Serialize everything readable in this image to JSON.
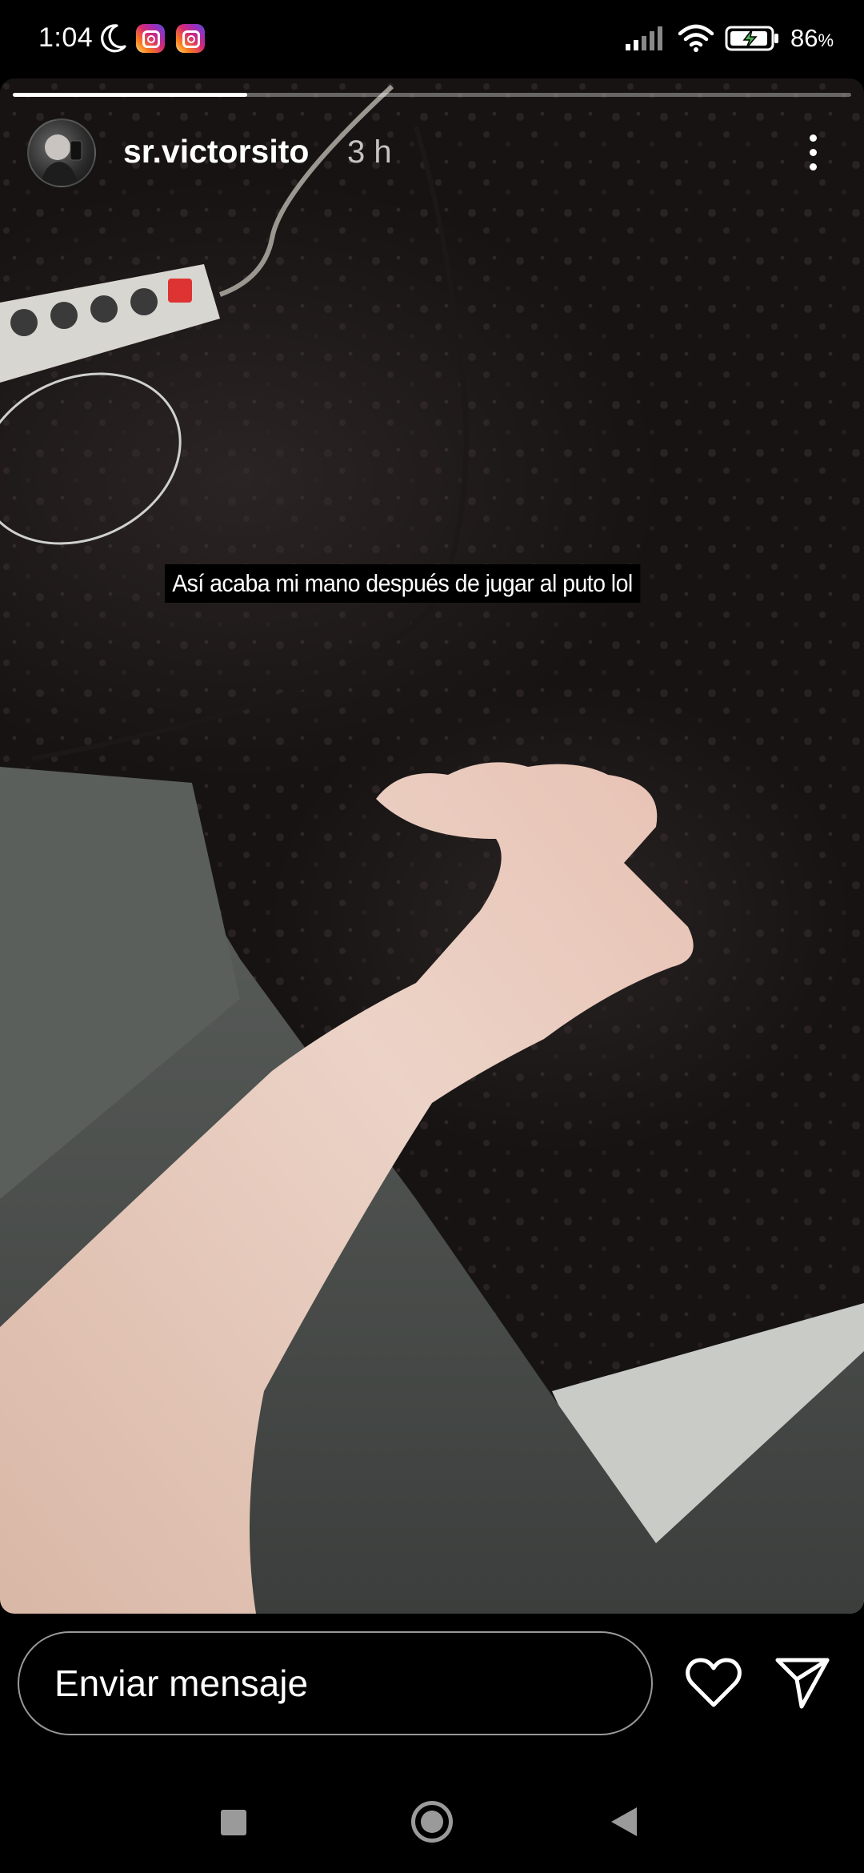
{
  "status_bar": {
    "time": "1:04",
    "battery_percent": "86",
    "battery_suffix": "%",
    "icons": [
      "moon-icon",
      "instagram-notification-icon",
      "instagram-notification-icon",
      "signal-icon",
      "wifi-icon",
      "battery-charging-icon"
    ]
  },
  "story": {
    "progress": 0.28,
    "username": "sr.victorsito",
    "time_ago": "3 h",
    "caption": "Así acaba mi mano después de jugar al puto lol"
  },
  "reply": {
    "placeholder": "Enviar mensaje"
  },
  "colors": {
    "background": "#000000",
    "text": "#ffffff",
    "nav_icons": "#9a9a9a"
  }
}
